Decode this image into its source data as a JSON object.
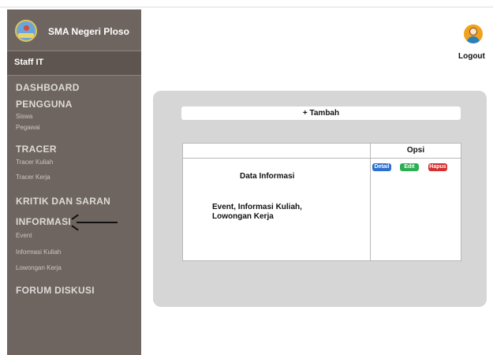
{
  "sidebar": {
    "school_name": "SMA Negeri Ploso",
    "role": "Staff IT",
    "menu": {
      "dashboard": "DASHBOARD",
      "pengguna": "PENGGUNA",
      "siswa": "Siswa",
      "pegawai": "Pegawai",
      "tracer": "TRACER",
      "tracer_kuliah": "Tracer Kuliah",
      "tracer_kerja": "Tracer Kerja",
      "kritik_saran": "KRITIK DAN SARAN",
      "informasi": "INFORMASI",
      "event": "Event",
      "informasi_kuliah": "Informasi Kuliah",
      "lowongan_kerja": "Lowongan Kerja",
      "forum_diskusi": "FORUM DISKUSI"
    }
  },
  "header": {
    "logout_label": "Logout"
  },
  "main": {
    "add_button_label": "+ Tambah",
    "table": {
      "header_empty": "",
      "opsi_header": "Opsi",
      "row_title": "Data Informasi",
      "row_desc": "Event, Informasi Kuliah, Lowongan Kerja",
      "actions": {
        "detail": "Detail",
        "edit": "Edit",
        "hapus": "Hapus"
      }
    }
  },
  "icons": {
    "logo": "school-logo-icon",
    "user": "user-avatar-icon",
    "arrow": "arrow-left-icon"
  },
  "colors": {
    "sidebar_bg": "#6f6560",
    "panel_bg": "#d6d6d6",
    "detail": "#2c6fd0",
    "edit": "#2cae52",
    "hapus": "#d43030",
    "user_icon": "#f0a21e"
  }
}
